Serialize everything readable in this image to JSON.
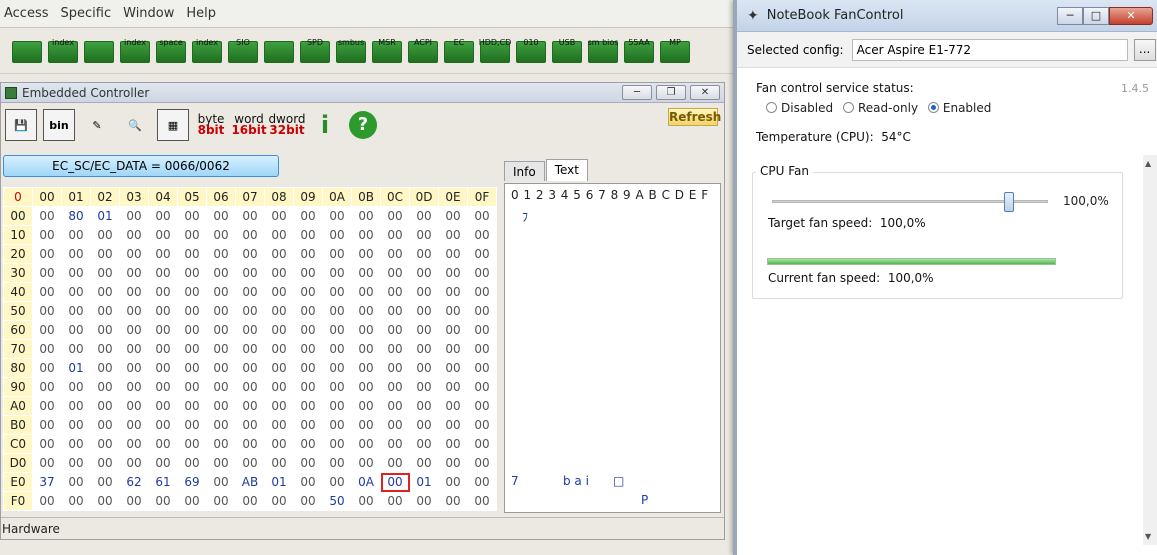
{
  "menu": [
    "Access",
    "Specific",
    "Window",
    "Help"
  ],
  "toolbar_icons": [
    {
      "name": "pci-icon",
      "label": ""
    },
    {
      "name": "pci-index-icon",
      "label": "index"
    },
    {
      "name": "memory-icon",
      "label": ""
    },
    {
      "name": "memory-index-icon",
      "label": "index"
    },
    {
      "name": "io-space-icon",
      "label": "space"
    },
    {
      "name": "io-index-icon",
      "label": "index"
    },
    {
      "name": "superio-icon",
      "label": "SIO"
    },
    {
      "name": "osc-icon",
      "label": ""
    },
    {
      "name": "spd-icon",
      "label": "SPD"
    },
    {
      "name": "smbus-icon",
      "label": "smbus"
    },
    {
      "name": "msr-icon",
      "label": "MSR"
    },
    {
      "name": "acpi-icon",
      "label": "ACPI"
    },
    {
      "name": "ec-icon",
      "label": "EC"
    },
    {
      "name": "hdd-icon",
      "label": "HDD,CD"
    },
    {
      "name": "disk-icon",
      "label": "010"
    },
    {
      "name": "usb-icon",
      "label": "USB"
    },
    {
      "name": "smbios-icon",
      "label": "sm bios"
    },
    {
      "name": "hex-icon",
      "label": "55AA"
    },
    {
      "name": "mp-icon",
      "label": "MP"
    }
  ],
  "ec": {
    "title": "Embedded Controller",
    "tools": [
      {
        "name": "save-icon",
        "label": ""
      },
      {
        "name": "bin-icon",
        "label": "bin"
      },
      {
        "name": "edit-icon",
        "label": ""
      },
      {
        "name": "find-icon",
        "label": ""
      },
      {
        "name": "grid-icon",
        "label": ""
      }
    ],
    "width_buttons": [
      {
        "top": "byte",
        "bottom": "8bit"
      },
      {
        "top": "word",
        "bottom": "16bit"
      },
      {
        "top": "dword",
        "bottom": "32bit"
      }
    ],
    "refresh": "Refresh",
    "address": "EC_SC/EC_DATA = 0066/0062",
    "corner": "0",
    "cols": [
      "00",
      "01",
      "02",
      "03",
      "04",
      "05",
      "06",
      "07",
      "08",
      "09",
      "0A",
      "0B",
      "0C",
      "0D",
      "0E",
      "0F"
    ],
    "rows": [
      {
        "h": "00",
        "v": [
          "00",
          "80",
          "01",
          "00",
          "00",
          "00",
          "00",
          "00",
          "00",
          "00",
          "00",
          "00",
          "00",
          "00",
          "00",
          "00"
        ]
      },
      {
        "h": "10",
        "v": [
          "00",
          "00",
          "00",
          "00",
          "00",
          "00",
          "00",
          "00",
          "00",
          "00",
          "00",
          "00",
          "00",
          "00",
          "00",
          "00"
        ]
      },
      {
        "h": "20",
        "v": [
          "00",
          "00",
          "00",
          "00",
          "00",
          "00",
          "00",
          "00",
          "00",
          "00",
          "00",
          "00",
          "00",
          "00",
          "00",
          "00"
        ]
      },
      {
        "h": "30",
        "v": [
          "00",
          "00",
          "00",
          "00",
          "00",
          "00",
          "00",
          "00",
          "00",
          "00",
          "00",
          "00",
          "00",
          "00",
          "00",
          "00"
        ]
      },
      {
        "h": "40",
        "v": [
          "00",
          "00",
          "00",
          "00",
          "00",
          "00",
          "00",
          "00",
          "00",
          "00",
          "00",
          "00",
          "00",
          "00",
          "00",
          "00"
        ]
      },
      {
        "h": "50",
        "v": [
          "00",
          "00",
          "00",
          "00",
          "00",
          "00",
          "00",
          "00",
          "00",
          "00",
          "00",
          "00",
          "00",
          "00",
          "00",
          "00"
        ]
      },
      {
        "h": "60",
        "v": [
          "00",
          "00",
          "00",
          "00",
          "00",
          "00",
          "00",
          "00",
          "00",
          "00",
          "00",
          "00",
          "00",
          "00",
          "00",
          "00"
        ]
      },
      {
        "h": "70",
        "v": [
          "00",
          "00",
          "00",
          "00",
          "00",
          "00",
          "00",
          "00",
          "00",
          "00",
          "00",
          "00",
          "00",
          "00",
          "00",
          "00"
        ]
      },
      {
        "h": "80",
        "v": [
          "00",
          "01",
          "00",
          "00",
          "00",
          "00",
          "00",
          "00",
          "00",
          "00",
          "00",
          "00",
          "00",
          "00",
          "00",
          "00"
        ]
      },
      {
        "h": "90",
        "v": [
          "00",
          "00",
          "00",
          "00",
          "00",
          "00",
          "00",
          "00",
          "00",
          "00",
          "00",
          "00",
          "00",
          "00",
          "00",
          "00"
        ]
      },
      {
        "h": "A0",
        "v": [
          "00",
          "00",
          "00",
          "00",
          "00",
          "00",
          "00",
          "00",
          "00",
          "00",
          "00",
          "00",
          "00",
          "00",
          "00",
          "00"
        ]
      },
      {
        "h": "B0",
        "v": [
          "00",
          "00",
          "00",
          "00",
          "00",
          "00",
          "00",
          "00",
          "00",
          "00",
          "00",
          "00",
          "00",
          "00",
          "00",
          "00"
        ]
      },
      {
        "h": "C0",
        "v": [
          "00",
          "00",
          "00",
          "00",
          "00",
          "00",
          "00",
          "00",
          "00",
          "00",
          "00",
          "00",
          "00",
          "00",
          "00",
          "00"
        ]
      },
      {
        "h": "D0",
        "v": [
          "00",
          "00",
          "00",
          "00",
          "00",
          "00",
          "00",
          "00",
          "00",
          "00",
          "00",
          "00",
          "00",
          "00",
          "00",
          "00"
        ]
      },
      {
        "h": "E0",
        "v": [
          "37",
          "00",
          "00",
          "62",
          "61",
          "69",
          "00",
          "AB",
          "01",
          "00",
          "00",
          "0A",
          "00",
          "01",
          "00",
          "00"
        ]
      },
      {
        "h": "F0",
        "v": [
          "00",
          "00",
          "00",
          "00",
          "00",
          "00",
          "00",
          "00",
          "00",
          "00",
          "50",
          "00",
          "00",
          "00",
          "00",
          "00"
        ]
      }
    ],
    "selected": {
      "row": "E0",
      "col": "0C"
    },
    "tabs": [
      "Info",
      "Text"
    ],
    "active_tab": "Text",
    "text_header": "0 1 2 3 4 5 6 7 8 9 A B C D E F",
    "text_row0": "ﾌ",
    "text_rowE0_a": "7",
    "text_rowE0_b": "b a i",
    "text_rowE0_c": "□",
    "text_rowF0": "P",
    "status": "Hardware"
  },
  "fc": {
    "title": "NoteBook FanControl",
    "config_label": "Selected config:",
    "config_value": "Acer Aspire E1-772",
    "config_button": "...",
    "version": "1.4.5",
    "service_label": "Fan control service status:",
    "options": [
      "Disabled",
      "Read-only",
      "Enabled"
    ],
    "selected_option": "Enabled",
    "temperature_label": "Temperature (CPU):",
    "temperature_value": "54°C",
    "fan_title": "CPU Fan",
    "slider_value": "100,0%",
    "target_label": "Target fan speed:",
    "target_value": "100,0%",
    "current_label": "Current fan speed:",
    "current_value": "100,0%",
    "progress_fraction": 1.0,
    "slider_fraction": 1.0
  }
}
